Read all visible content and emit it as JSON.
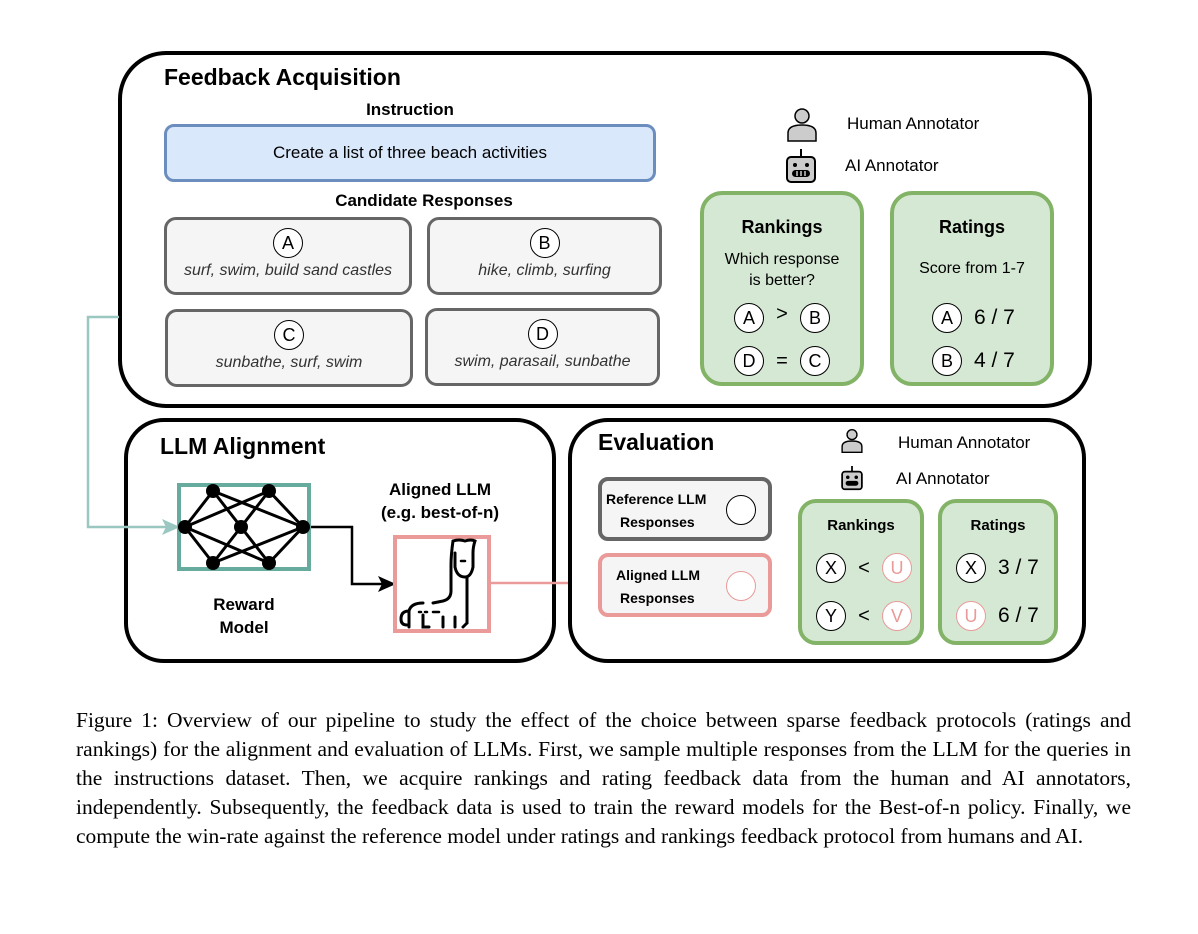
{
  "feedback_acquisition": {
    "title": "Feedback Acquisition",
    "instruction_label": "Instruction",
    "instruction_text": "Create a list of three beach activities",
    "candidates_label": "Candidate Responses",
    "responses": [
      {
        "id": "A",
        "text": "surf, swim, build sand castles"
      },
      {
        "id": "B",
        "text": "hike, climb, surfing"
      },
      {
        "id": "C",
        "text": "sunbathe, surf, swim"
      },
      {
        "id": "D",
        "text": "swim, parasail, sunbathe"
      }
    ],
    "legend": {
      "human": "Human Annotator",
      "ai": "AI Annotator"
    },
    "rankings": {
      "title": "Rankings",
      "question_line1": "Which response",
      "question_line2": "is better?",
      "rows": [
        {
          "left": "A",
          "op": ">",
          "right": "B"
        },
        {
          "left": "D",
          "op": "=",
          "right": "C"
        }
      ]
    },
    "ratings": {
      "title": "Ratings",
      "subtitle": "Score from 1-7",
      "rows": [
        {
          "id": "A",
          "score": "6 / 7"
        },
        {
          "id": "B",
          "score": "4 / 7"
        }
      ]
    }
  },
  "llm_alignment": {
    "title": "LLM Alignment",
    "reward_model_line1": "Reward",
    "reward_model_line2": "Model",
    "aligned_llm_line1": "Aligned LLM",
    "aligned_llm_line2": "(e.g. best-of-n)"
  },
  "evaluation": {
    "title": "Evaluation",
    "legend": {
      "human": "Human Annotator",
      "ai": "AI Annotator"
    },
    "reference_line1": "Reference LLM",
    "reference_line2": "Responses",
    "aligned_line1": "Aligned LLM",
    "aligned_line2": "Responses",
    "rankings": {
      "title": "Rankings",
      "rows": [
        {
          "left": "X",
          "op": "<",
          "right": "U"
        },
        {
          "left": "Y",
          "op": "<",
          "right": "V"
        }
      ]
    },
    "ratings": {
      "title": "Ratings",
      "rows": [
        {
          "id": "X",
          "score": "3 / 7"
        },
        {
          "id": "U",
          "score": "6 / 7"
        }
      ]
    }
  },
  "colors": {
    "instruction_fill": "#dae8fc",
    "instruction_border": "#6c8ebf",
    "green_fill": "#d5e8d4",
    "green_border": "#82b366",
    "teal": "#67ab9f",
    "pink": "#ea9a98"
  },
  "caption": "Figure 1: Overview of our pipeline to study the effect of the choice between sparse feedback protocols (ratings and rankings) for the alignment and evaluation of LLMs. First, we sample multiple responses from the LLM for the queries in the instructions dataset. Then, we acquire rankings and rating feedback data from the human and AI annotators, independently. Subsequently, the feedback data is used to train the reward models for the Best-of-n policy. Finally, we compute the win-rate against the reference model under ratings and rankings feedback protocol from humans and AI."
}
